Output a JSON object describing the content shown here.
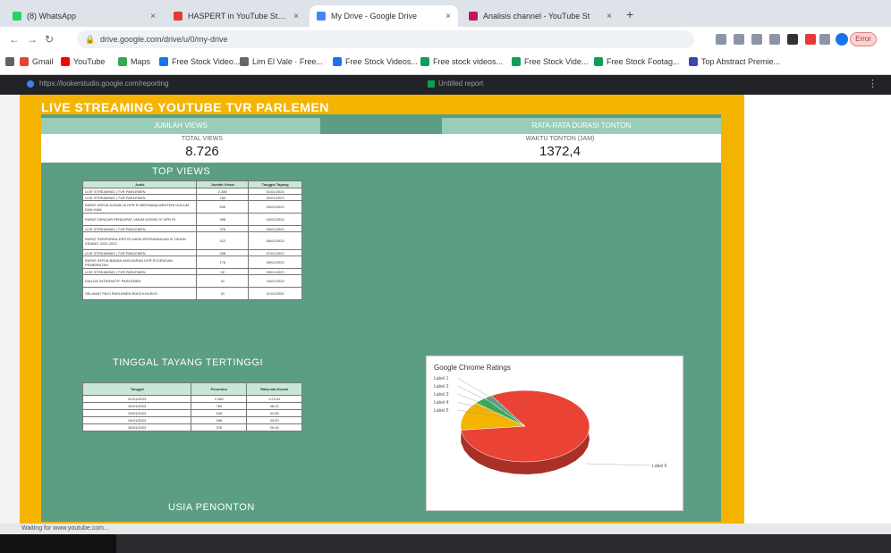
{
  "browser": {
    "tabs": [
      {
        "label": "(8) WhatsApp",
        "color": "#25d366",
        "active": false
      },
      {
        "label": "HASPERT in YouTube Stats",
        "color": "#e53935",
        "active": false
      },
      {
        "label": "My Drive - Google Drive",
        "color": "#4285f4",
        "active": true
      },
      {
        "label": "Analisis channel - YouTube St",
        "color": "#c2185b",
        "active": false
      }
    ],
    "address": "drive.google.com/drive/u/0/my-drive",
    "bookmarks": [
      {
        "label": "Gmail",
        "color": "#ea4335"
      },
      {
        "label": "YouTube",
        "color": "#ff0000"
      },
      {
        "label": "Maps",
        "color": "#34a853"
      },
      {
        "label": "Free Stock Video...",
        "color": "#1a73e8"
      },
      {
        "label": "Lim El Vale · Free...",
        "color": "#666666"
      },
      {
        "label": "Free Stock Videos...",
        "color": "#1a73e8"
      },
      {
        "label": "Free stock videos...",
        "color": "#0f9d58"
      },
      {
        "label": "Free Stock Vide...",
        "color": "#0f9d58"
      },
      {
        "label": "Free Stock Footag...",
        "color": "#0f9d58"
      },
      {
        "label": "Top Abstract Premie...",
        "color": "#3949ab"
      }
    ],
    "profile_label": "Error"
  },
  "viewer": {
    "url": "https://lookerstudio.google.com/reporting",
    "doc_title": "Untitled report"
  },
  "dashboard": {
    "title": "LIVE STREAMING YOUTUBE TVR PARLEMEN",
    "left_header": "JUMLAH VIEWS",
    "right_header": "RATA-RATA DURASI TONTON",
    "kpi_left_label": "TOTAL VIEWS",
    "kpi_left_value": "8.726",
    "kpi_right_label": "WAKTU TONTON (JAM)",
    "kpi_right_value": "1372,4",
    "top_views_title": "TOP VIEWS",
    "top_views_headers": [
      "Judul",
      "Jumlah Views",
      "Tanggal Tayang"
    ],
    "top_views_rows": [
      [
        "LIVE STREAMING | TVR PARLEMEN",
        "2.380",
        "01/01/2023"
      ],
      [
        "LIVE STREAMING | TVR PARLEMEN",
        "789",
        "02/01/2023"
      ],
      [
        "RAPAT KERJA KOMISI III DPR RI BERSAMA MENTERI HUKUM DAN HAM",
        "545",
        "03/01/2023"
      ],
      [
        "RAPAT DENGAR PENDAPAT UMUM KOMISI IV DPR RI",
        "398",
        "04/01/2023"
      ],
      [
        "LIVE STREAMING | TVR PARLEMEN",
        "376",
        "05/01/2023"
      ],
      [
        "RAPAT PARIPURNA DPR RI MASA PERSIDANGAN III TAHUN SIDANG 2022-2023",
        "312",
        "06/01/2023"
      ],
      [
        "LIVE STREAMING | TVR PARLEMEN",
        "298",
        "07/01/2023"
      ],
      [
        "RAPAT KERJA BADAN ANGGARAN DPR RI DENGAN PEMERINTAH",
        "176",
        "08/01/2023"
      ],
      [
        "LIVE STREAMING | TVR PARLEMEN",
        "92",
        "09/01/2023"
      ],
      [
        "DIALOG INTERAKTIF PARLEMEN",
        "41",
        "10/01/2023"
      ],
      [
        "SELAMAT PAGI PARLEMEN EDISI KHUSUS",
        "31",
        "11/01/2023"
      ]
    ],
    "duration_title": "TINGGAL TAYANG TERTINGGI",
    "duration_headers": [
      "Tanggal",
      "Penonton",
      "Rata-rata Durasi"
    ],
    "duration_rows": [
      [
        "01/01/2023",
        "2.380",
        "1:23:41"
      ],
      [
        "02/01/2023",
        "789",
        "48:12"
      ],
      [
        "03/01/2023",
        "545",
        "41:05"
      ],
      [
        "04/01/2023",
        "398",
        "33:29"
      ],
      [
        "05/01/2023",
        "376",
        "29:16"
      ]
    ],
    "bottom_title": "USIA PENONTON",
    "pie_title": "Google Chrome Ratings",
    "pie_labels": [
      "Label 1",
      "Label 2",
      "Label 3",
      "Label 4",
      "Label 5"
    ],
    "pie_main_label": "Label 6"
  },
  "chart_data": {
    "type": "pie",
    "title": "Google Chrome Ratings",
    "series": [
      {
        "values": [
          82,
          13,
          3,
          2
        ],
        "colors": [
          "#ea4335",
          "#f4b400",
          "#34a853",
          "#5c9e84"
        ]
      }
    ]
  },
  "status": {
    "text": "Waiting for www.youtube.com..."
  }
}
